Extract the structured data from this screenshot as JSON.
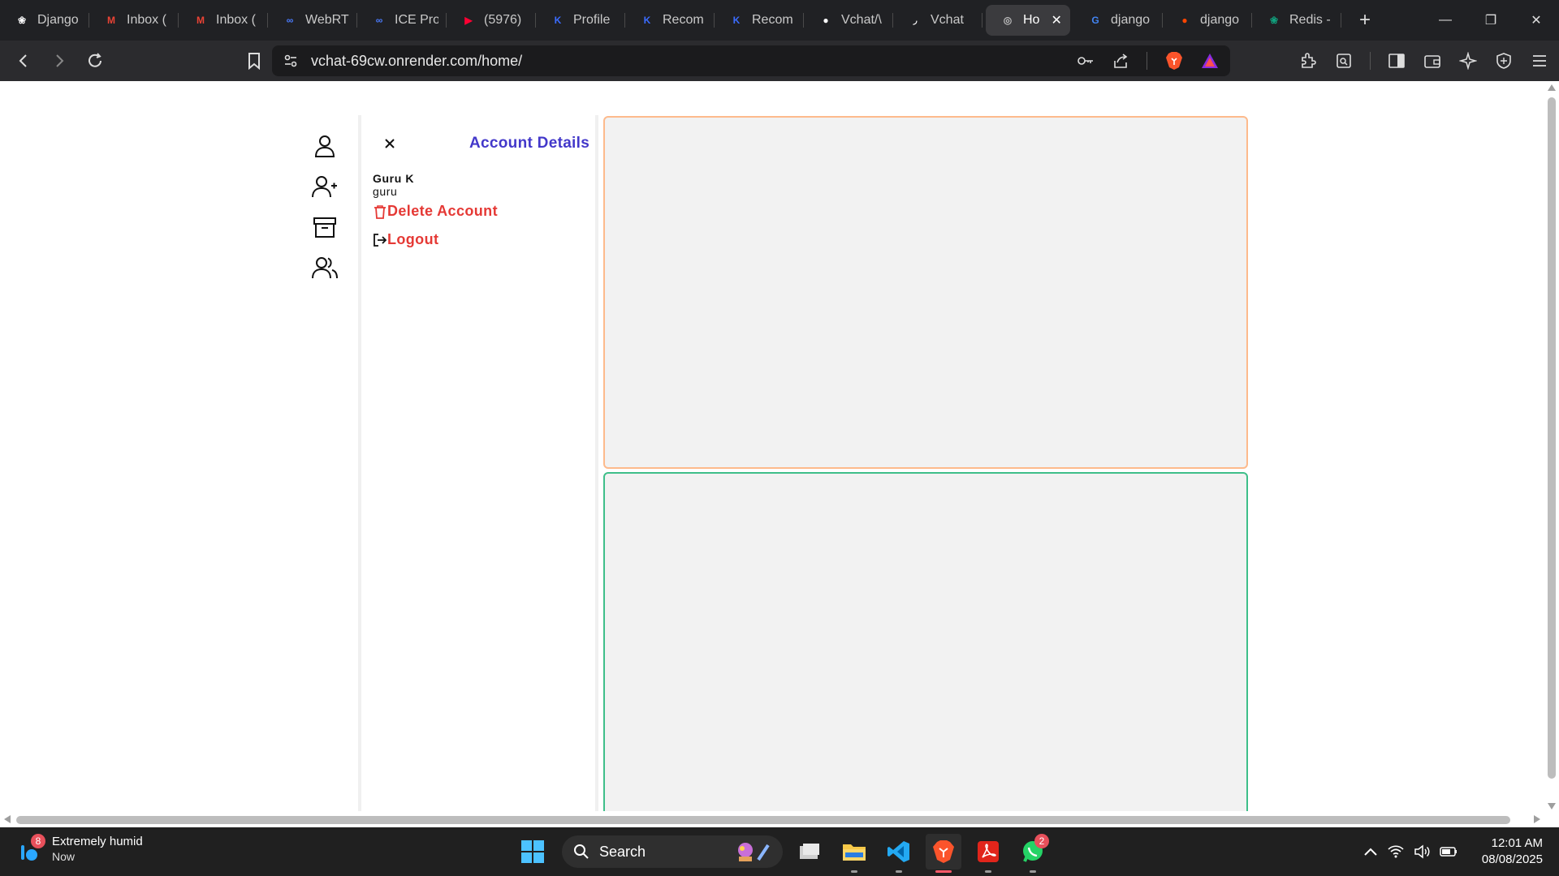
{
  "browser": {
    "tabs": [
      {
        "label": "Django",
        "icon": "openai-icon",
        "color": "#ffffff"
      },
      {
        "label": "Inbox (",
        "icon": "gmail-icon",
        "color": "#ea4335"
      },
      {
        "label": "Inbox (",
        "icon": "gmail-icon",
        "color": "#ea4335"
      },
      {
        "label": "WebRT",
        "icon": "meta-icon",
        "color": "#4a7cff"
      },
      {
        "label": "ICE Pro",
        "icon": "meta-icon",
        "color": "#4a7cff"
      },
      {
        "label": "(5976)",
        "icon": "youtube-icon",
        "color": "#ff0033"
      },
      {
        "label": "Profile",
        "icon": "kotlin-icon",
        "color": "#3b6cff"
      },
      {
        "label": "Recom",
        "icon": "kotlin-icon",
        "color": "#3b6cff"
      },
      {
        "label": "Recom",
        "icon": "kotlin-icon",
        "color": "#3b6cff"
      },
      {
        "label": "Vchat/\\",
        "icon": "github-icon",
        "color": "#ffffff"
      },
      {
        "label": "Vchat",
        "icon": "render-icon",
        "color": "#ffffff"
      },
      {
        "label": "Ho",
        "icon": "globe-icon",
        "color": "#bbbbbb",
        "active": true
      },
      {
        "label": "django",
        "icon": "google-icon",
        "color": "#4285f4"
      },
      {
        "label": "django",
        "icon": "reddit-icon",
        "color": "#ff4500"
      },
      {
        "label": "Redis -",
        "icon": "openai-icon",
        "color": "#10a37f"
      }
    ],
    "url": "vchat-69cw.onrender.com/home/"
  },
  "app": {
    "panel": {
      "title": "Account Details",
      "user_name": "Guru K",
      "user_handle": "guru",
      "delete_label": "Delete Account",
      "logout_label": "Logout"
    },
    "colors": {
      "title": "#4338ca",
      "danger": "#e53935",
      "local_video_border": "#fdba8c",
      "remote_video_border": "#3fbf8a"
    }
  },
  "taskbar": {
    "weather_badge": "8",
    "weather_title": "Extremely humid",
    "weather_sub": "Now",
    "search_label": "Search",
    "whatsapp_badge": "2",
    "time": "12:01 AM",
    "date": "08/08/2025"
  }
}
